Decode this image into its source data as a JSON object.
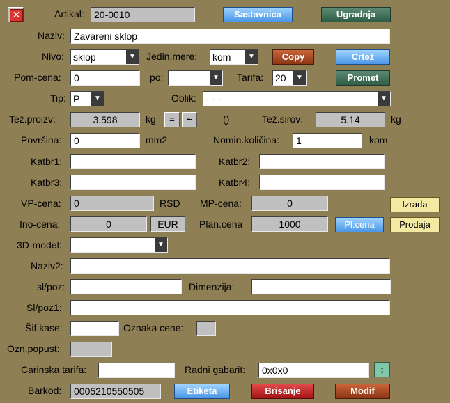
{
  "header": {
    "close_icon": "close-x-icon",
    "artikal_label": "Artikal:",
    "artikal_value": "20-0010",
    "sastavnica_btn": "Sastavnica",
    "ugradnja_btn": "Ugradnja"
  },
  "naziv": {
    "label": "Naziv:",
    "value": "Zavareni sklop"
  },
  "nivo": {
    "label": "Nivo:",
    "value": "sklop"
  },
  "jedin_mere": {
    "label": "Jedin.mere:",
    "value": "kom"
  },
  "copy_btn": "Copy",
  "crtez_btn": "Crtež",
  "pom_cena": {
    "label": "Pom-cena:",
    "value": "0"
  },
  "po": {
    "label": "po:",
    "value": ""
  },
  "tarifa": {
    "label": "Tarifa:",
    "value": "20"
  },
  "promet_btn": "Promet",
  "tip": {
    "label": "Tip:",
    "value": "P"
  },
  "oblik": {
    "label": "Oblik:",
    "value": "- - -"
  },
  "tez_proizv": {
    "label": "Tež.proizv:",
    "value": "3.598",
    "unit": "kg"
  },
  "eq_btn": "=",
  "approx_btn": "~",
  "paren_text": "()",
  "tez_sirov": {
    "label": "Tež.sirov:",
    "value": "5.14",
    "unit": "kg"
  },
  "povrsina": {
    "label": "Površina:",
    "value": "0",
    "unit": "mm2"
  },
  "nomin_kolicina": {
    "label": "Nomin.količina:",
    "value": "1",
    "unit": "kom"
  },
  "katbr1": {
    "label": "Katbr1:",
    "value": ""
  },
  "katbr2": {
    "label": "Katbr2:",
    "value": ""
  },
  "katbr3": {
    "label": "Katbr3:",
    "value": ""
  },
  "katbr4": {
    "label": "Katbr4:",
    "value": ""
  },
  "vp_cena": {
    "label": "VP-cena:",
    "value": "0",
    "unit": "RSD"
  },
  "mp_cena": {
    "label": "MP-cena:",
    "value": "0"
  },
  "izrada_btn": "Izrada",
  "ino_cena": {
    "label": "Ino-cena:",
    "value": "0",
    "currency": "EUR"
  },
  "plan_cena": {
    "label": "Plan.cena",
    "value": "1000"
  },
  "plcena_btn": "Pl.cena",
  "prodaja_btn": "Prodaja",
  "model_3d": {
    "label": "3D-model:",
    "value": ""
  },
  "naziv2": {
    "label": "Naziv2:",
    "value": ""
  },
  "sl_poz": {
    "label": "sl/poz:",
    "value": ""
  },
  "dimenzija": {
    "label": "Dimenzija:",
    "value": ""
  },
  "sl_poz1": {
    "label": "Sl/poz1:",
    "value": ""
  },
  "sif_kase": {
    "label": "Šif.kase:",
    "value": ""
  },
  "oznaka_cene": {
    "label": "Oznaka cene:",
    "value": ""
  },
  "ozn_popust": {
    "label": "Ozn.popust:",
    "value": ""
  },
  "carinska_tarifa": {
    "label": "Carinska tarifa:",
    "value": ""
  },
  "radni_gabarit": {
    "label": "Radni gabarit:",
    "value": "0x0x0"
  },
  "semicolon_btn": ";",
  "barkod": {
    "label": "Barkod:",
    "value": "0005210550505"
  },
  "etiketa_btn": "Etiketa",
  "brisanje_btn": "Brisanje",
  "modif_btn": "Modif"
}
